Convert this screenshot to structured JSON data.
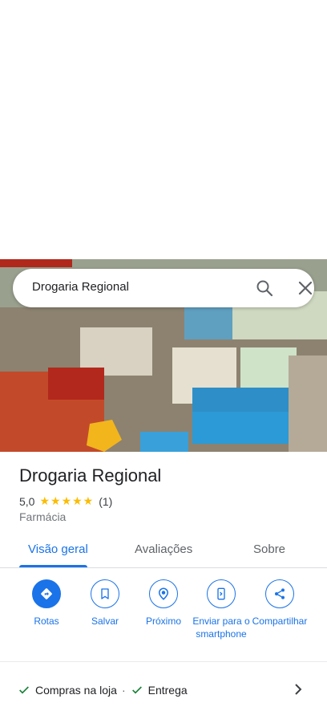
{
  "search": {
    "query": "Drogaria Regional"
  },
  "place": {
    "name": "Drogaria Regional",
    "rating": "5,0",
    "stars": "★★★★★",
    "reviews_count": "(1)",
    "category": "Farmácia"
  },
  "tabs": [
    {
      "label": "Visão geral",
      "active": true
    },
    {
      "label": "Avaliações",
      "active": false
    },
    {
      "label": "Sobre",
      "active": false
    }
  ],
  "actions": [
    {
      "label": "Rotas",
      "icon": "directions-icon"
    },
    {
      "label": "Salvar",
      "icon": "bookmark-icon"
    },
    {
      "label": "Próximo",
      "icon": "nearby-icon"
    },
    {
      "label": "Enviar para o smartphone",
      "icon": "send-to-phone-icon"
    },
    {
      "label": "Compartilhar",
      "icon": "share-icon"
    }
  ],
  "services": [
    {
      "label": "Compras na loja"
    },
    {
      "label": "Entrega"
    }
  ],
  "services_separator": "·",
  "colors": {
    "accent": "#1a73e8",
    "star": "#fbbc04",
    "check": "#188038"
  }
}
